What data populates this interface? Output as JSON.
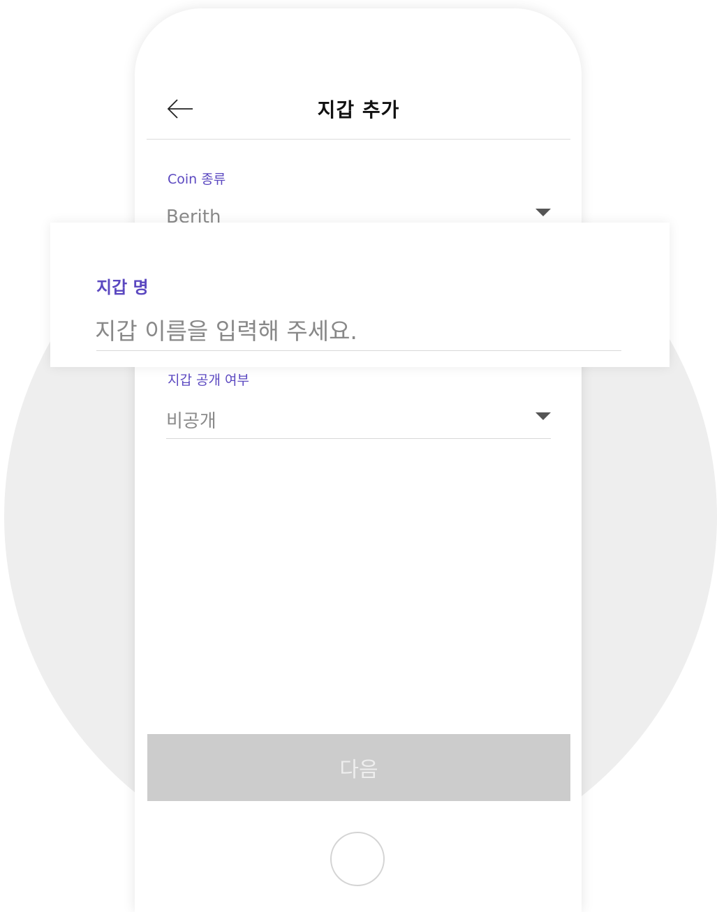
{
  "header": {
    "title": "지갑 추가",
    "back_icon": "arrow-left-icon"
  },
  "form": {
    "coin_type": {
      "label": "Coin 종류",
      "value": "Berith",
      "icon": "dropdown-triangle-icon"
    },
    "wallet_name": {
      "label": "지갑 명",
      "placeholder": "지갑 이름을 입력해 주세요."
    },
    "wallet_visibility": {
      "label": "지갑 공개 여부",
      "value": "비공개",
      "icon": "dropdown-triangle-icon"
    }
  },
  "actions": {
    "next_label": "다음"
  },
  "colors": {
    "accent": "#5b48c0",
    "background_circle": "#eeeeee",
    "button_disabled": "#cccccc"
  }
}
